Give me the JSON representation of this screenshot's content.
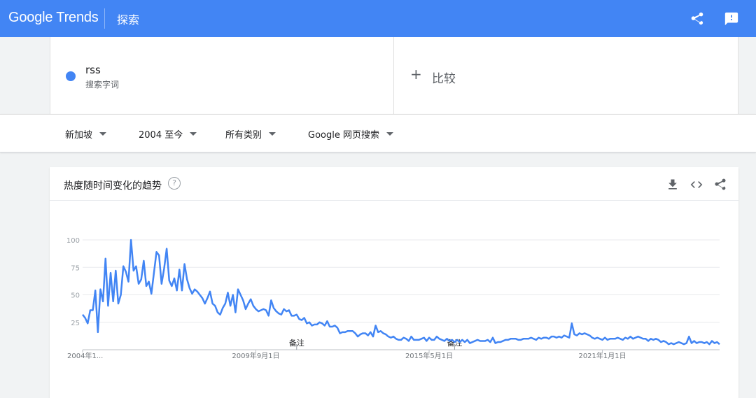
{
  "header": {
    "logo_google": "Google",
    "logo_trends": "Trends",
    "section": "探索"
  },
  "term": {
    "name": "rss",
    "type_label": "搜索字词",
    "color": "#4285f4"
  },
  "compare": {
    "plus": "+",
    "label": "比较"
  },
  "filters": {
    "region": "新加坡",
    "time": "2004 至今",
    "category": "所有类别",
    "search_type": "Google 网页搜索"
  },
  "card": {
    "title": "热度随时间变化的趋势",
    "help": "?"
  },
  "chart_data": {
    "type": "line",
    "ylim": [
      0,
      100
    ],
    "yticks": [
      25,
      50,
      75,
      100
    ],
    "xtick_labels": [
      "2004年1...",
      "2009年9月1日",
      "2015年5月1日",
      "2021年1月1日"
    ],
    "xtick_positions": [
      0,
      68,
      136,
      204
    ],
    "annotations": [
      {
        "label": "备注",
        "index": 84
      },
      {
        "label": "备注",
        "index": 146
      }
    ],
    "series": [
      {
        "color": "#4285f4",
        "values": [
          32,
          29,
          24,
          36,
          36,
          54,
          16,
          55,
          44,
          83,
          40,
          70,
          44,
          72,
          42,
          50,
          76,
          71,
          62,
          100,
          72,
          76,
          60,
          64,
          81,
          58,
          62,
          51,
          70,
          89,
          86,
          60,
          74,
          92,
          63,
          58,
          65,
          54,
          73,
          54,
          78,
          64,
          56,
          51,
          55,
          53,
          50,
          47,
          42,
          47,
          53,
          42,
          40,
          34,
          32,
          38,
          42,
          52,
          40,
          50,
          34,
          55,
          50,
          45,
          37,
          42,
          46,
          40,
          37,
          35,
          36,
          37,
          36,
          31,
          45,
          38,
          35,
          33,
          32,
          37,
          35,
          36,
          31,
          31,
          32,
          28,
          27,
          29,
          24,
          25,
          22,
          23,
          23,
          25,
          24,
          22,
          26,
          21,
          21,
          22,
          20,
          15,
          16,
          16,
          17,
          17,
          17,
          15,
          12,
          14,
          15,
          15,
          13,
          16,
          12,
          22,
          16,
          17,
          15,
          14,
          12,
          11,
          12,
          10,
          9,
          9,
          11,
          10,
          8,
          12,
          9,
          9,
          9,
          10,
          11,
          8,
          11,
          9,
          9,
          12,
          10,
          9,
          8,
          10,
          8,
          9,
          7,
          9,
          7,
          9,
          7,
          9,
          6,
          7,
          8,
          9,
          8,
          8,
          8,
          9,
          7,
          11,
          6,
          7,
          7,
          8,
          9,
          9,
          10,
          10,
          10,
          9,
          9,
          10,
          10,
          10,
          11,
          10,
          9,
          11,
          10,
          11,
          11,
          10,
          12,
          12,
          11,
          12,
          11,
          13,
          12,
          11,
          24,
          14,
          13,
          15,
          14,
          15,
          14,
          13,
          11,
          10,
          11,
          10,
          9,
          11,
          9,
          10,
          10,
          10,
          11,
          10,
          9,
          11,
          10,
          12,
          10,
          11,
          12,
          11,
          10,
          10,
          8,
          10,
          9,
          10,
          9,
          7,
          8,
          7,
          5,
          6,
          5,
          6,
          7,
          6,
          5,
          6,
          12,
          6,
          8,
          6,
          7,
          7,
          6,
          7,
          5,
          8,
          6,
          7,
          5
        ]
      }
    ]
  }
}
